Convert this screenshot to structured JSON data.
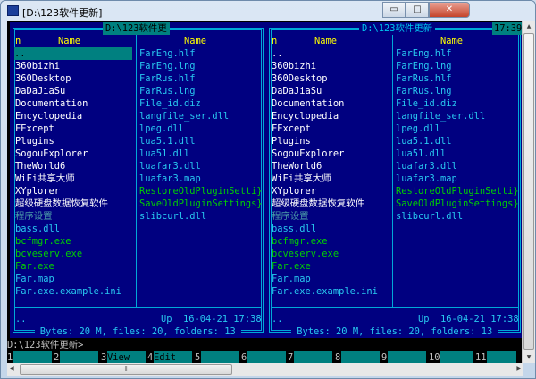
{
  "window": {
    "title": "[D:\\123软件更新]",
    "minimize": "▭",
    "maximize": "□",
    "close": "✕"
  },
  "colors": {
    "panel": "#000080",
    "dir": "#ffffff",
    "dll": "#28c8f0",
    "exe": "#00d000",
    "hidden": "#4a9aa8",
    "selected_bg": "#008080",
    "header": "#ffff00"
  },
  "left_panel": {
    "title": "D:\\123软件更",
    "col_n": "n",
    "col1_header": "Name",
    "col2_header": "Name",
    "col1": [
      {
        "name": "..",
        "type": "selected"
      },
      {
        "name": "360bizhi",
        "type": "dir"
      },
      {
        "name": "360Desktop",
        "type": "dir"
      },
      {
        "name": "DaDaJiaSu",
        "type": "dir"
      },
      {
        "name": "Documentation",
        "type": "dir"
      },
      {
        "name": "Encyclopedia",
        "type": "dir"
      },
      {
        "name": "FExcept",
        "type": "dir"
      },
      {
        "name": "Plugins",
        "type": "dir"
      },
      {
        "name": "SogouExplorer",
        "type": "dir"
      },
      {
        "name": "TheWorld6",
        "type": "dir"
      },
      {
        "name": "WiFi共享大师",
        "type": "dir"
      },
      {
        "name": "XYplorer",
        "type": "dir"
      },
      {
        "name": "超级硬盘数据恢复软件",
        "type": "dir"
      },
      {
        "name": "程序设置",
        "type": "hidden"
      },
      {
        "name": "bass.dll",
        "type": "dll"
      },
      {
        "name": "bcfmgr.exe",
        "type": "exe"
      },
      {
        "name": "bcveserv.exe",
        "type": "exe"
      },
      {
        "name": "Far.exe",
        "type": "exe"
      },
      {
        "name": "Far.map",
        "type": "dll"
      },
      {
        "name": "Far.exe.example.ini",
        "type": "dll"
      }
    ],
    "col2": [
      {
        "name": "FarEng.hlf",
        "type": "dll"
      },
      {
        "name": "FarEng.lng",
        "type": "dll"
      },
      {
        "name": "FarRus.hlf",
        "type": "dll"
      },
      {
        "name": "FarRus.lng",
        "type": "dll"
      },
      {
        "name": "File_id.diz",
        "type": "dll"
      },
      {
        "name": "langfile_ser.dll",
        "type": "dll"
      },
      {
        "name": "lpeg.dll",
        "type": "dll"
      },
      {
        "name": "lua5.1.dll",
        "type": "dll"
      },
      {
        "name": "lua51.dll",
        "type": "dll"
      },
      {
        "name": "luafar3.dll",
        "type": "dll"
      },
      {
        "name": "luafar3.map",
        "type": "dll"
      },
      {
        "name": "RestoreOldPluginSetti}",
        "type": "exe"
      },
      {
        "name": "SaveOldPluginSettings}",
        "type": "exe"
      },
      {
        "name": "slibcurl.dll",
        "type": "dll"
      }
    ],
    "info_name": "..",
    "info_size": "Up",
    "info_date": "16-04-21 17:38",
    "summary": " Bytes: 20 M, files: 20, folders: 13 "
  },
  "right_panel": {
    "title": "D:\\123软件更新",
    "col_n": "n",
    "col1_header": "Name",
    "col2_header": "Name",
    "col1": [
      {
        "name": "..",
        "type": "dir"
      },
      {
        "name": "360bizhi",
        "type": "dir"
      },
      {
        "name": "360Desktop",
        "type": "dir"
      },
      {
        "name": "DaDaJiaSu",
        "type": "dir"
      },
      {
        "name": "Documentation",
        "type": "dir"
      },
      {
        "name": "Encyclopedia",
        "type": "dir"
      },
      {
        "name": "FExcept",
        "type": "dir"
      },
      {
        "name": "Plugins",
        "type": "dir"
      },
      {
        "name": "SogouExplorer",
        "type": "dir"
      },
      {
        "name": "TheWorld6",
        "type": "dir"
      },
      {
        "name": "WiFi共享大师",
        "type": "dir"
      },
      {
        "name": "XYplorer",
        "type": "dir"
      },
      {
        "name": "超级硬盘数据恢复软件",
        "type": "dir"
      },
      {
        "name": "程序设置",
        "type": "hidden"
      },
      {
        "name": "bass.dll",
        "type": "dll"
      },
      {
        "name": "bcfmgr.exe",
        "type": "exe"
      },
      {
        "name": "bcveserv.exe",
        "type": "exe"
      },
      {
        "name": "Far.exe",
        "type": "exe"
      },
      {
        "name": "Far.map",
        "type": "dll"
      },
      {
        "name": "Far.exe.example.ini",
        "type": "dll"
      }
    ],
    "col2": [
      {
        "name": "FarEng.hlf",
        "type": "dll"
      },
      {
        "name": "FarEng.lng",
        "type": "dll"
      },
      {
        "name": "FarRus.hlf",
        "type": "dll"
      },
      {
        "name": "FarRus.lng",
        "type": "dll"
      },
      {
        "name": "File_id.diz",
        "type": "dll"
      },
      {
        "name": "langfile_ser.dll",
        "type": "dll"
      },
      {
        "name": "lpeg.dll",
        "type": "dll"
      },
      {
        "name": "lua5.1.dll",
        "type": "dll"
      },
      {
        "name": "lua51.dll",
        "type": "dll"
      },
      {
        "name": "luafar3.dll",
        "type": "dll"
      },
      {
        "name": "luafar3.map",
        "type": "dll"
      },
      {
        "name": "RestoreOldPluginSetti}",
        "type": "exe"
      },
      {
        "name": "SaveOldPluginSettings}",
        "type": "exe"
      },
      {
        "name": "slibcurl.dll",
        "type": "dll"
      }
    ],
    "info_name": "..",
    "info_size": "Up",
    "info_date": "16-04-21 17:38",
    "summary": " Bytes: 20 M, files: 20, folders: 13 "
  },
  "clock": "17:39",
  "command_line": "D:\\123软件更新>",
  "keybar": [
    {
      "num": "1",
      "label": ""
    },
    {
      "num": "2",
      "label": ""
    },
    {
      "num": "3",
      "label": "View"
    },
    {
      "num": "4",
      "label": "Edit"
    },
    {
      "num": "5",
      "label": ""
    },
    {
      "num": "6",
      "label": ""
    },
    {
      "num": "7",
      "label": ""
    },
    {
      "num": "8",
      "label": ""
    },
    {
      "num": "9",
      "label": ""
    },
    {
      "num": "10",
      "label": ""
    },
    {
      "num": "11",
      "label": ""
    }
  ],
  "scrollbar": {
    "grip": "⦀",
    "up": "▲",
    "down": "▼",
    "left": "◀",
    "right": "▶"
  }
}
